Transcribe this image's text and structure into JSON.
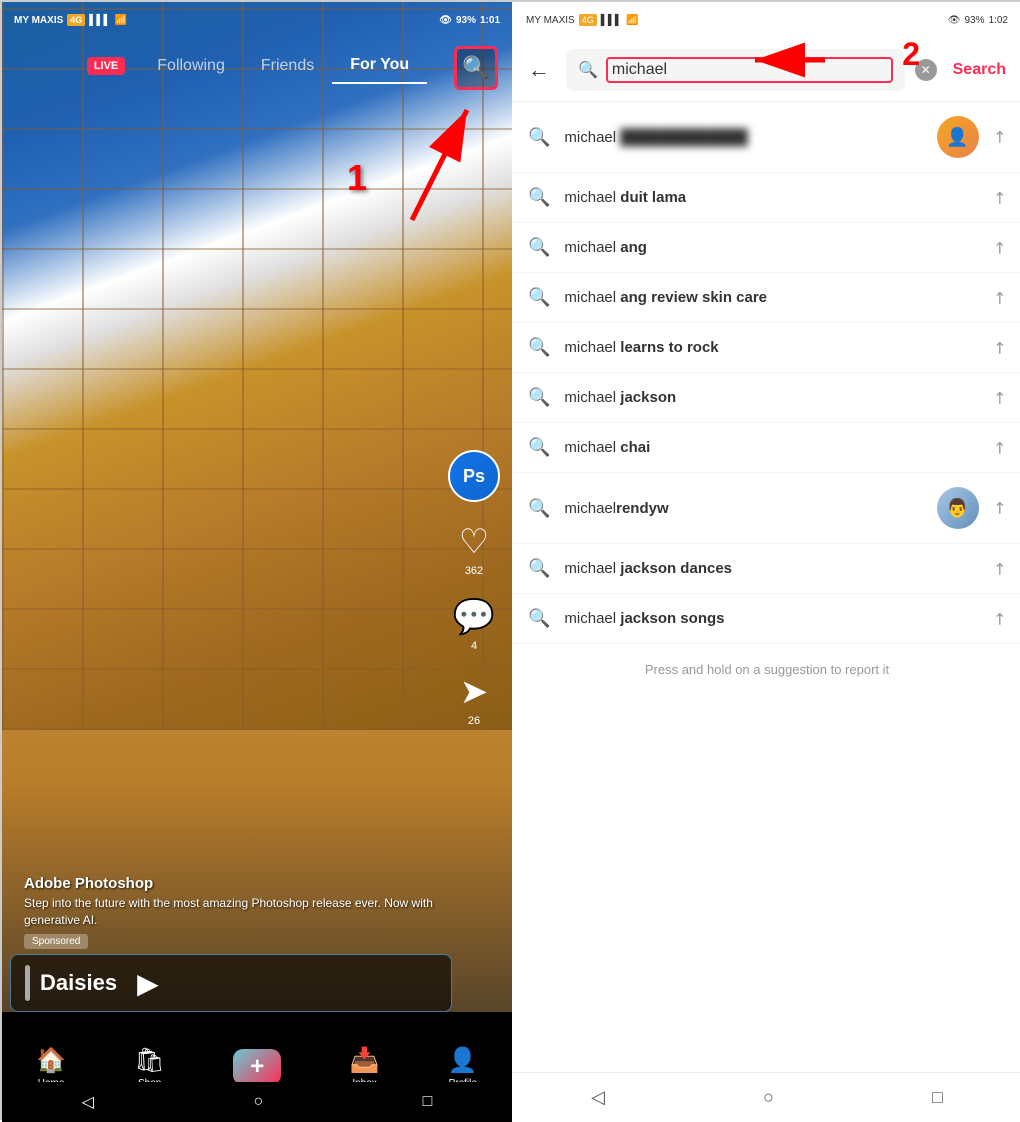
{
  "left": {
    "status_bar": {
      "carrier": "MY MAXIS",
      "network": "4G",
      "signal": "▌▌▌",
      "wifi": "WiFi",
      "battery": "93",
      "time": "1:01"
    },
    "nav": {
      "live_label": "LIVE",
      "items": [
        {
          "id": "following",
          "label": "Following",
          "active": false
        },
        {
          "id": "friends",
          "label": "Friends",
          "active": false
        },
        {
          "id": "foryou",
          "label": "For You",
          "active": true
        }
      ]
    },
    "annotation": {
      "number": "1"
    },
    "music": {
      "title": "Daisies"
    },
    "ad": {
      "title": "Adobe Photoshop",
      "desc": "Step into the future with the most amazing Photoshop release ever. Now with generative AI.",
      "badge": "Sponsored"
    },
    "right_controls": {
      "likes": "362",
      "comments": "4",
      "shares": "26"
    },
    "bottom_nav": {
      "items": [
        {
          "id": "home",
          "label": "Home",
          "icon": "🏠",
          "active": true
        },
        {
          "id": "shop",
          "label": "Shop",
          "icon": "🛍"
        },
        {
          "id": "create",
          "label": "",
          "icon": "+"
        },
        {
          "id": "inbox",
          "label": "Inbox",
          "icon": "📥"
        },
        {
          "id": "profile",
          "label": "Profile",
          "icon": "👤"
        }
      ]
    }
  },
  "right": {
    "status_bar": {
      "carrier": "MY MAXIS",
      "network": "4G",
      "battery": "93",
      "time": "1:02"
    },
    "search": {
      "query": "michael",
      "placeholder": "michael",
      "search_label": "Search",
      "annotation_number": "2"
    },
    "suggestions": [
      {
        "id": "s1",
        "prefix": "michael ",
        "bold": "",
        "has_avatar": true,
        "avatar_type": "person",
        "blurred": true
      },
      {
        "id": "s2",
        "prefix": "michael ",
        "bold": "duit lama",
        "has_avatar": false
      },
      {
        "id": "s3",
        "prefix": "michael ",
        "bold": "ang",
        "has_avatar": false
      },
      {
        "id": "s4",
        "prefix": "michael ",
        "bold": "ang review skin care",
        "has_avatar": false
      },
      {
        "id": "s5",
        "prefix": "michael ",
        "bold": "learns to rock",
        "has_avatar": false
      },
      {
        "id": "s6",
        "prefix": "michael ",
        "bold": "jackson",
        "has_avatar": false
      },
      {
        "id": "s7",
        "prefix": "michael ",
        "bold": "chai",
        "has_avatar": false
      },
      {
        "id": "s8",
        "prefix": "michael",
        "bold": "rendyw",
        "has_avatar": true,
        "avatar_type": "man"
      },
      {
        "id": "s9",
        "prefix": "michael ",
        "bold": "jackson dances",
        "has_avatar": false
      },
      {
        "id": "s10",
        "prefix": "michael ",
        "bold": "jackson songs",
        "has_avatar": false
      }
    ],
    "hint": "Press and hold on a suggestion to report it"
  }
}
